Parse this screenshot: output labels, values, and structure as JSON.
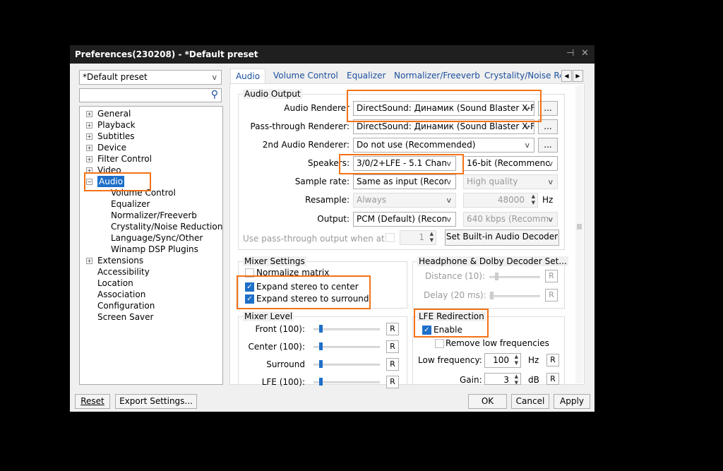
{
  "window": {
    "title": "Preferences(230208) - *Default preset",
    "pin": "⊣",
    "close": "✕"
  },
  "left": {
    "preset": "*Default preset",
    "search_placeholder": "",
    "tree": [
      {
        "label": "General",
        "expander": "+"
      },
      {
        "label": "Playback",
        "expander": "+"
      },
      {
        "label": "Subtitles",
        "expander": "+"
      },
      {
        "label": "Device",
        "expander": "+"
      },
      {
        "label": "Filter Control",
        "expander": "+"
      },
      {
        "label": "Video",
        "expander": "+"
      },
      {
        "label": "Audio",
        "expander": "−",
        "selected": true
      },
      {
        "label": "Volume Control",
        "child": true
      },
      {
        "label": "Equalizer",
        "child": true
      },
      {
        "label": "Normalizer/Freeverb",
        "child": true
      },
      {
        "label": "Crystality/Noise Reduction",
        "child": true
      },
      {
        "label": "Language/Sync/Other",
        "child": true
      },
      {
        "label": "Winamp DSP Plugins",
        "child": true
      },
      {
        "label": "Extensions",
        "expander": "+"
      },
      {
        "label": "Accessibility"
      },
      {
        "label": "Location"
      },
      {
        "label": "Association"
      },
      {
        "label": "Configuration"
      },
      {
        "label": "Screen Saver"
      }
    ]
  },
  "tabs": [
    "Audio",
    "Volume Control",
    "Equalizer",
    "Normalizer/Freeverb",
    "Crystality/Noise Red"
  ],
  "audio_output": {
    "title": "Audio Output",
    "audio_renderer": {
      "label": "Audio Renderer",
      "value": "DirectSound: Динамик (Sound Blaster X-F"
    },
    "pass_renderer": {
      "label": "Pass-through Renderer:",
      "value": "DirectSound: Динамик (Sound Blaster X-F"
    },
    "second_renderer": {
      "label": "2nd Audio Renderer:",
      "value": "Do not use (Recommended)"
    },
    "speakers": {
      "label": "Speakers:",
      "value": "3/0/2+LFE - 5.1 Chan",
      "bits": "16-bit (Recommenc"
    },
    "sample_rate": {
      "label": "Sample rate:",
      "value": "Same as input (Recor",
      "quality": "High quality"
    },
    "resample": {
      "label": "Resample:",
      "value": "Always",
      "hz_value": "48000",
      "hz_unit": "Hz"
    },
    "output": {
      "label": "Output:",
      "value": "PCM (Default) (Recon",
      "bitrate": "640 kbps (Recomm"
    },
    "passthrough_when": {
      "label": "Use pass-through output when at...",
      "value": "1"
    },
    "set_decoder": "Set Built-in Audio Decoder",
    "more": "..."
  },
  "mixer_settings": {
    "title": "Mixer Settings",
    "normalize": "Normalize matrix",
    "expand_center": "Expand stereo to center",
    "expand_surround": "Expand stereo to surround",
    "normalize_checked": false,
    "expand_center_checked": true,
    "expand_surround_checked": true
  },
  "headphone": {
    "title": "Headphone & Dolby Decoder Set...",
    "distance": "Distance (10):",
    "delay": "Delay (20 ms):",
    "reset": "R"
  },
  "mixer_level": {
    "title": "Mixer Level",
    "rows": [
      {
        "label": "Front (100):",
        "value": 100
      },
      {
        "label": "Center (100):",
        "value": 100
      },
      {
        "label": "Surround",
        "value": 100
      },
      {
        "label": "LFE (100):",
        "value": 100
      }
    ],
    "reset": "R"
  },
  "lfe": {
    "title": "LFE Redirection",
    "enable": "Enable",
    "enable_checked": true,
    "remove_low": "Remove low frequencies",
    "remove_low_checked": false,
    "low_freq_label": "Low frequency:",
    "low_freq": "100",
    "low_freq_unit": "Hz",
    "gain_label": "Gain:",
    "gain": "3",
    "gain_unit": "dB",
    "reset": "R"
  },
  "footer": {
    "reset": "Reset",
    "export": "Export Settings...",
    "ok": "OK",
    "cancel": "Cancel",
    "apply": "Apply"
  },
  "colors": {
    "highlight": "#f47216",
    "accent": "#1e6fc8"
  }
}
